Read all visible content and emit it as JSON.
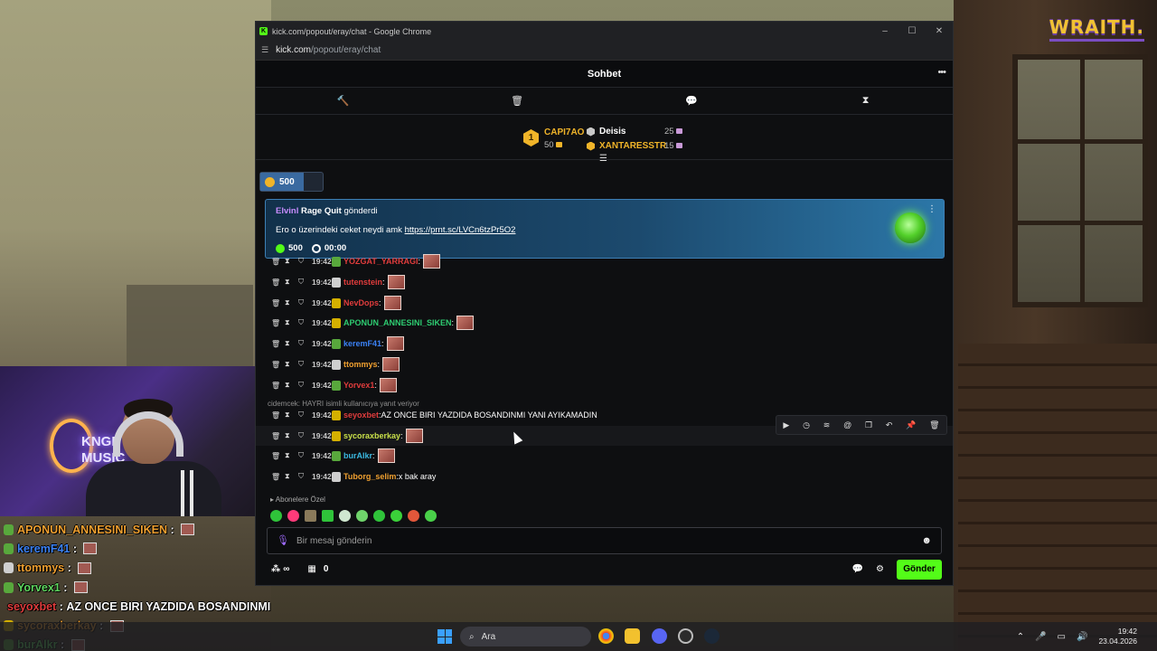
{
  "brand": "WRAITH.",
  "browser": {
    "title": "kick.com/popout/eray/chat - Google Chrome",
    "address_domain": "kick.com",
    "address_path": "/popout/eray/chat"
  },
  "chat": {
    "title": "Sohbet",
    "leaderboard": {
      "first": {
        "rank": "1",
        "name": "CAPI7AO",
        "count": "50"
      },
      "rows": [
        {
          "name": "Deisis",
          "count": "25",
          "color": "#ffffff"
        },
        {
          "name": "XANTARESSTR",
          "count": "15",
          "color": "#f0b429"
        }
      ]
    },
    "kicks_total": "500",
    "pinned": {
      "sender": "Elvinl",
      "item": "Rage Quit",
      "verb": "gönderdi",
      "message": "Ero o üzerindeki ceket neydi amk",
      "link": "https://prnt.sc/LVCn6tzPr5O2",
      "amount": "500",
      "timer": "00:00"
    },
    "messages": [
      {
        "time": "19:42",
        "user": "YOZGAT_YARRAGI",
        "color": "#e03c3c",
        "badge": "#58a83c",
        "text": "",
        "emote": true
      },
      {
        "time": "19:42",
        "user": "tutenstein",
        "color": "#e03c3c",
        "badge": "#cfcfcf",
        "text": "",
        "emote": true
      },
      {
        "time": "19:42",
        "user": "NevDops",
        "color": "#e03c3c",
        "badge": "#d4b000",
        "text": "",
        "emote": true
      },
      {
        "time": "19:42",
        "user": "APONUN_ANNESINI_SIKEN",
        "color": "#2ecc71",
        "badge": "#d4b000",
        "text": "",
        "emote": true
      },
      {
        "time": "19:42",
        "user": "keremF41",
        "color": "#3b82f6",
        "badge": "#58a83c",
        "text": "",
        "emote": true
      },
      {
        "time": "19:42",
        "user": "ttommys",
        "color": "#f0a030",
        "badge": "#cfcfcf",
        "text": "",
        "emote": true
      },
      {
        "time": "19:42",
        "user": "Yorvex1",
        "color": "#e03c3c",
        "badge": "#58a83c",
        "text": "",
        "emote": true
      },
      {
        "time": "19:42",
        "user": "seyoxbet",
        "color": "#e03c3c",
        "badge": "#d4b000",
        "text": " AZ ONCE BIRI YAZDIDA BOSANDINMI YANI AYIKAMADIN",
        "emote": false
      },
      {
        "time": "19:42",
        "user": "sycoraxberkay",
        "color": "#c9e04a",
        "badge": "#d4b000",
        "text": "",
        "emote": true
      },
      {
        "time": "19:42",
        "user": "burAlkr",
        "color": "#3bb8e0",
        "badge": "#58a83c",
        "text": "",
        "emote": true
      },
      {
        "time": "19:42",
        "user": "Tuborg_selim",
        "color": "#f0a030",
        "badge": "#cfcfcf",
        "text": " x bak aray",
        "emote": false
      }
    ],
    "reply_note": "cidemcek: HAYRI isimli kullanıcıya yanıt veriyor",
    "sub_note": "Abonelere Özel",
    "input_placeholder": "Bir mesaj gönderin",
    "bottom": {
      "infinity": "∞",
      "count": "0",
      "send": "Gönder"
    }
  },
  "overlay_chat": [
    {
      "user": "APONUN_ANNESINI_SIKEN",
      "color": "#f0a030",
      "badge": "#58a83c",
      "text": "",
      "emote": true
    },
    {
      "user": "keremF41",
      "color": "#3b82f6",
      "badge": "#58a83c",
      "text": "",
      "emote": true
    },
    {
      "user": "ttommys",
      "color": "#f0a030",
      "badge": "#cfcfcf",
      "text": "",
      "emote": true
    },
    {
      "user": "Yorvex1",
      "color": "#5fd65f",
      "badge": "#58a83c",
      "text": "",
      "emote": true
    },
    {
      "user": "seyoxbet",
      "color": "#e03c3c",
      "badge": "#d4b000",
      "text": "AZ ONCE BIRI YAZDIDA BOSANDINMI",
      "emote": false
    },
    {
      "user": "sycoraxberkay",
      "color": "#f0a030",
      "badge": "#d4b000",
      "text": "",
      "emote": true
    },
    {
      "user": "burAlkr",
      "color": "#5fd65f",
      "badge": "#58a83c",
      "text": "",
      "emote": true
    }
  ],
  "webcam_sign": "KNGL\nMUSIC",
  "taskbar": {
    "search_label": "Ara",
    "time": "19:42",
    "date": "23.04.2026"
  }
}
